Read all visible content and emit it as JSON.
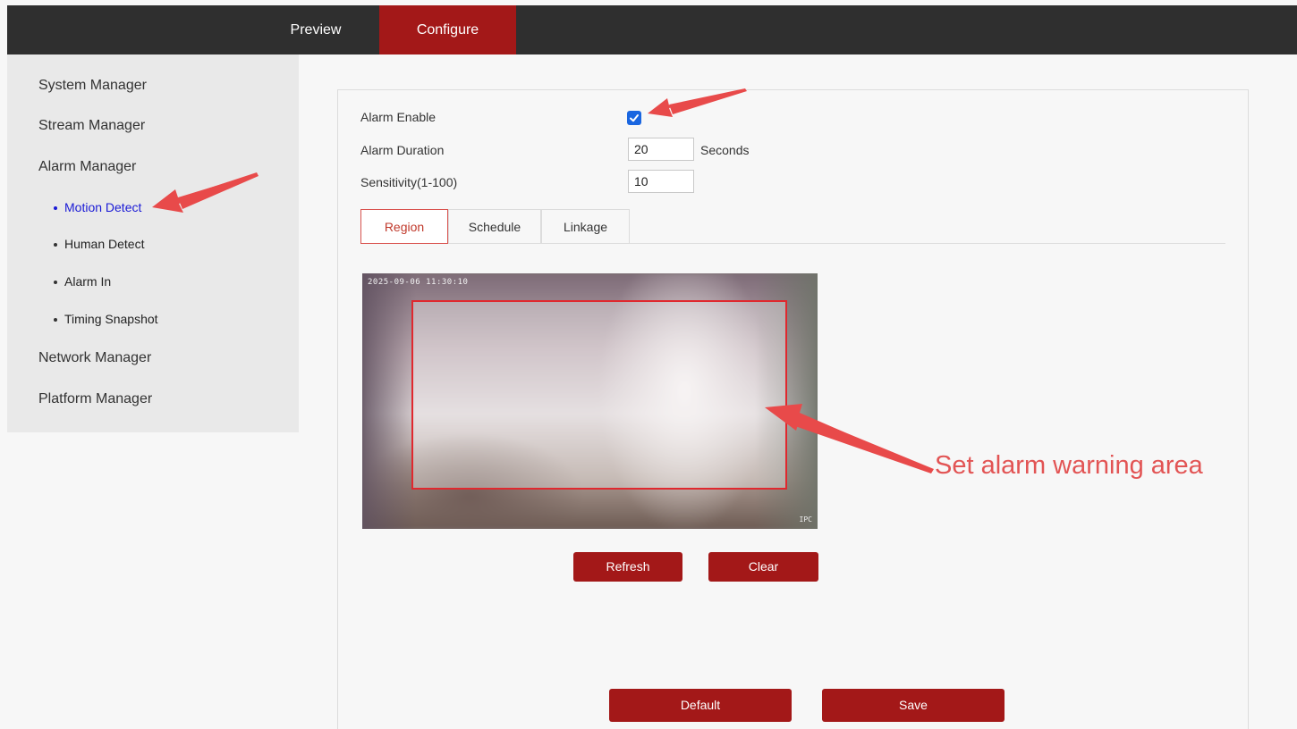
{
  "nav": {
    "tabs": [
      {
        "label": "Preview"
      },
      {
        "label": "Configure",
        "active": true
      }
    ]
  },
  "sidebar": {
    "items": [
      {
        "label": "System Manager"
      },
      {
        "label": "Stream Manager"
      },
      {
        "label": "Alarm Manager"
      },
      {
        "label": "Network Manager"
      },
      {
        "label": "Platform Manager"
      }
    ],
    "alarm_subitems": [
      {
        "label": "Motion Detect",
        "active": true
      },
      {
        "label": "Human Detect"
      },
      {
        "label": "Alarm In"
      },
      {
        "label": "Timing Snapshot"
      }
    ]
  },
  "form": {
    "alarm_enable_label": "Alarm Enable",
    "alarm_enable_checked": true,
    "alarm_duration_label": "Alarm Duration",
    "alarm_duration_value": "20",
    "alarm_duration_unit": "Seconds",
    "sensitivity_label": "Sensitivity(1-100)",
    "sensitivity_value": "10"
  },
  "subtabs": [
    {
      "label": "Region",
      "active": true
    },
    {
      "label": "Schedule"
    },
    {
      "label": "Linkage"
    }
  ],
  "video": {
    "timestamp": "2025-09-06 11:30:10",
    "corner_mark": "IPC"
  },
  "buttons": {
    "refresh": "Refresh",
    "clear": "Clear",
    "default": "Default",
    "save": "Save"
  },
  "annotation": {
    "text": "Set alarm warning area",
    "color": "#e25454"
  },
  "colors": {
    "brand": "#a31818",
    "topbar": "#2f2f2f",
    "active_link": "#1a1ad6",
    "checkbox": "#1a66e0",
    "region_border": "#e0282e"
  }
}
